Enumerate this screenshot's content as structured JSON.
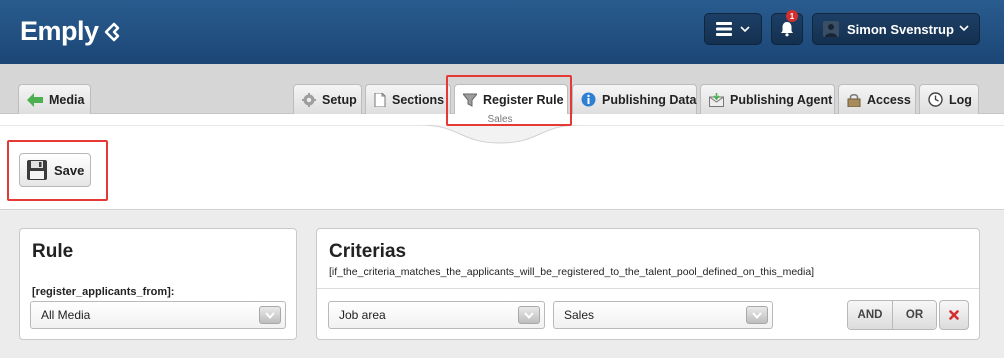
{
  "header": {
    "logo": "Emply",
    "notifications_count": "1",
    "user_name": "Simon Svenstrup"
  },
  "tabs": {
    "back": "Media",
    "items": [
      "Setup",
      "Sections",
      "Register Rule",
      "Publishing Data",
      "Publishing Agent",
      "Access",
      "Log"
    ],
    "active": "Register Rule"
  },
  "section_label": "Sales",
  "toolbar": {
    "save_label": "Save"
  },
  "rule_panel": {
    "title": "Rule",
    "field_label": "[register_applicants_from]:",
    "select_value": "All Media"
  },
  "criteria_panel": {
    "title": "Criterias",
    "description": "[if_the_criteria_matches_the_applicants_will_be_registered_to_the_talent_pool_defined_on_this_media]",
    "field_select": "Job area",
    "value_select": "Sales",
    "and_label": "AND",
    "or_label": "OR"
  },
  "colors": {
    "header": "#1f4b7c",
    "highlight": "#e53935",
    "back_arrow": "#4caf50",
    "delete_x": "#d32f2f"
  },
  "icons": [
    "chevron-down-icon",
    "menu-icon",
    "bell-icon",
    "user-icon",
    "back-arrow-icon",
    "gear-icon",
    "document-icon",
    "filter-icon",
    "info-icon",
    "agent-icon",
    "lock-icon",
    "clock-icon",
    "floppy-icon",
    "close-icon"
  ]
}
